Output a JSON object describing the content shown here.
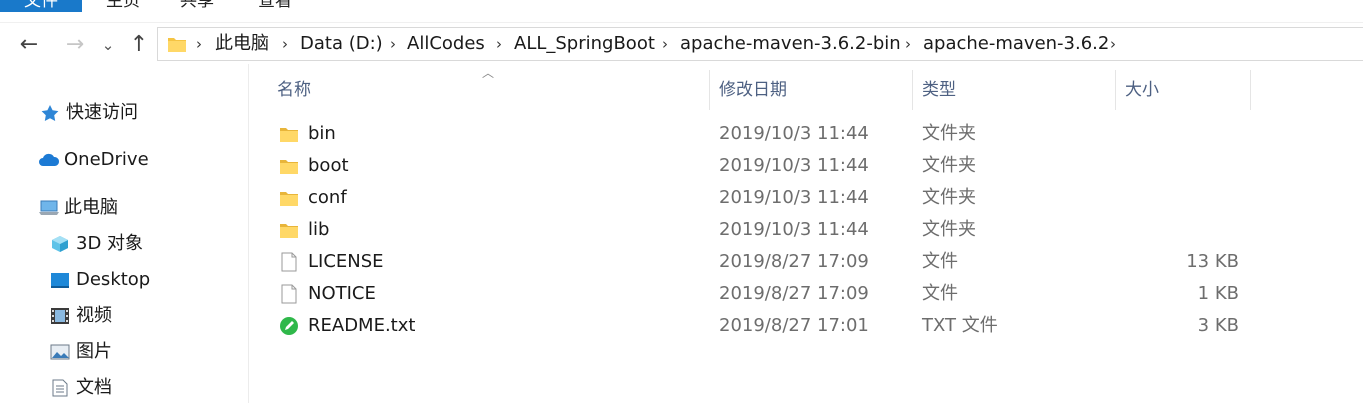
{
  "ribbon": {
    "tabs": [
      "文件",
      "主页",
      "共享",
      "查看"
    ]
  },
  "nav": {
    "back": "←",
    "forward": "→",
    "recent": "⌄",
    "up": "↑"
  },
  "address": {
    "crumbs": [
      "此电脑",
      "Data (D:)",
      "AllCodes",
      "ALL_SpringBoot",
      "apache-maven-3.6.2-bin",
      "apache-maven-3.6.2"
    ],
    "separator": "›"
  },
  "sidebar": {
    "items": [
      {
        "label": "快速访问",
        "icon": "star-icon"
      },
      {
        "label": "OneDrive",
        "icon": "cloud-icon"
      },
      {
        "label": "此电脑",
        "icon": "computer-icon"
      },
      {
        "label": "3D 对象",
        "icon": "cube-icon"
      },
      {
        "label": "Desktop",
        "icon": "desktop-icon"
      },
      {
        "label": "视频",
        "icon": "video-icon"
      },
      {
        "label": "图片",
        "icon": "picture-icon"
      },
      {
        "label": "文档",
        "icon": "document-icon"
      }
    ]
  },
  "columns": {
    "name": "名称",
    "modified": "修改日期",
    "type": "类型",
    "size": "大小"
  },
  "files": [
    {
      "name": "bin",
      "modified": "2019/10/3 11:44",
      "type": "文件夹",
      "size": "",
      "icon": "folder-icon"
    },
    {
      "name": "boot",
      "modified": "2019/10/3 11:44",
      "type": "文件夹",
      "size": "",
      "icon": "folder-icon"
    },
    {
      "name": "conf",
      "modified": "2019/10/3 11:44",
      "type": "文件夹",
      "size": "",
      "icon": "folder-icon"
    },
    {
      "name": "lib",
      "modified": "2019/10/3 11:44",
      "type": "文件夹",
      "size": "",
      "icon": "folder-icon"
    },
    {
      "name": "LICENSE",
      "modified": "2019/8/27 17:09",
      "type": "文件",
      "size": "13 KB",
      "icon": "file-icon"
    },
    {
      "name": "NOTICE",
      "modified": "2019/8/27 17:09",
      "type": "文件",
      "size": "1 KB",
      "icon": "file-icon"
    },
    {
      "name": "README.txt",
      "modified": "2019/8/27 17:01",
      "type": "TXT 文件",
      "size": "3 KB",
      "icon": "text-file-icon"
    }
  ],
  "colors": {
    "file_tab": "#1979ca",
    "header_text": "#4d6082",
    "folder": "#f5c443"
  }
}
